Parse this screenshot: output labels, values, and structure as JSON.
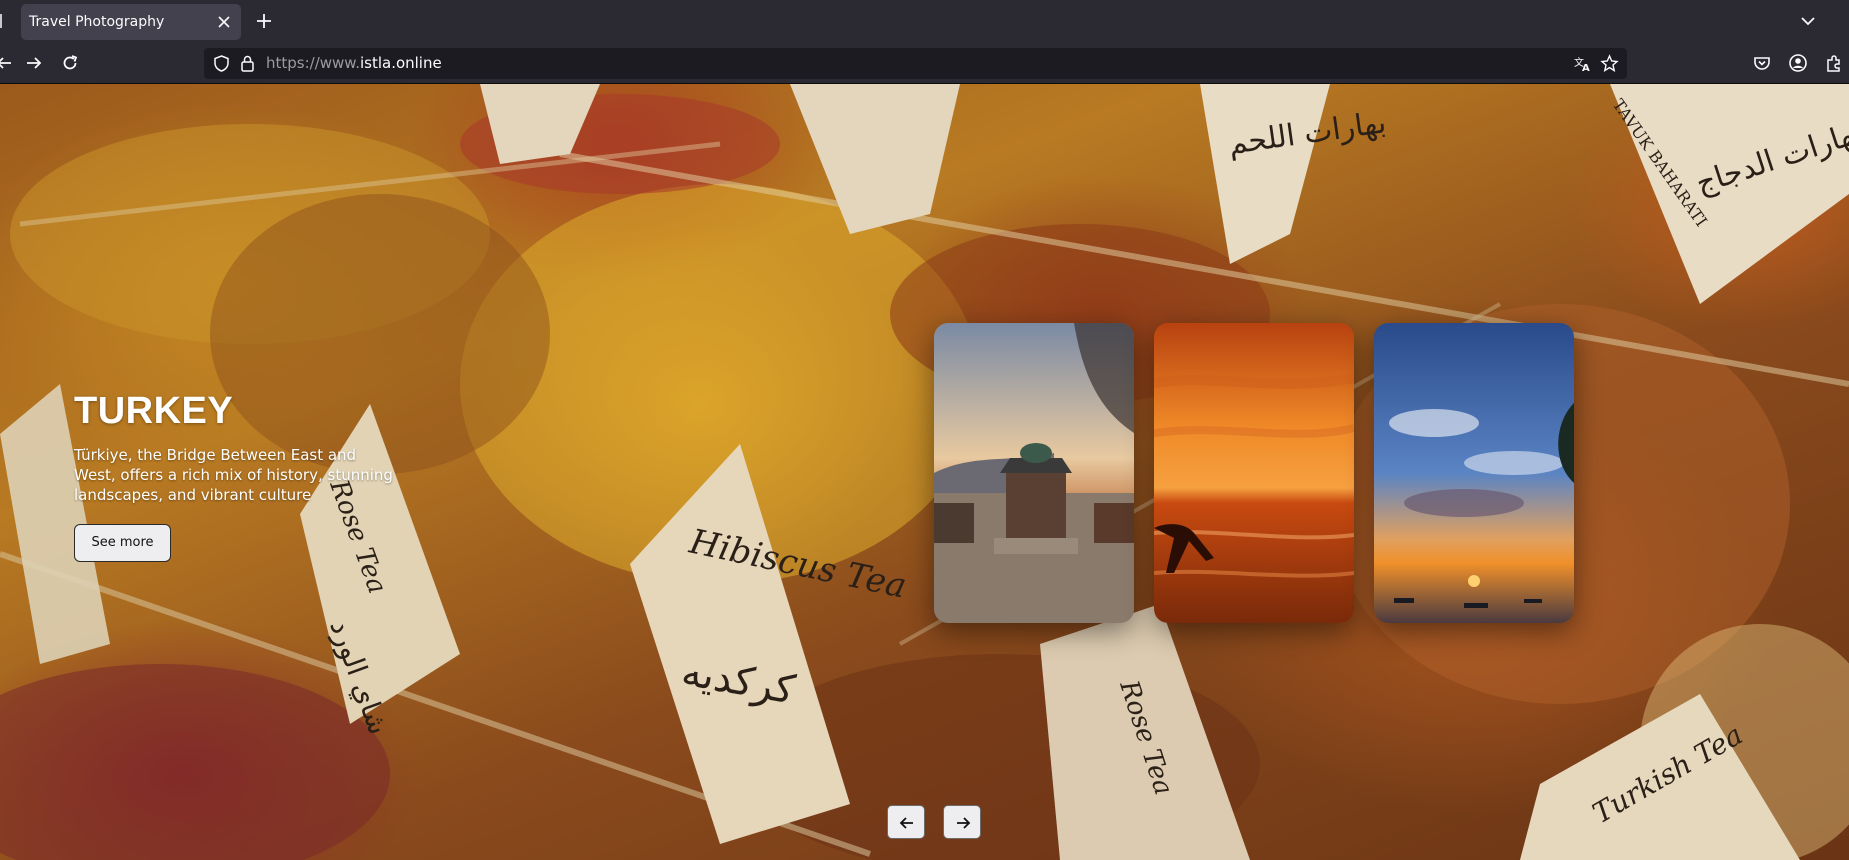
{
  "browser": {
    "tab": {
      "title": "Travel Photography"
    },
    "url": {
      "prefix": "https://www.",
      "host": "istla.online"
    },
    "icons": [
      "back-arrow-icon",
      "forward-arrow-icon",
      "reload-icon",
      "shield-icon",
      "lock-icon",
      "translate-icon",
      "bookmark-star-icon",
      "pocket-icon",
      "account-icon",
      "extensions-icon",
      "new-tab-plus-icon",
      "tab-list-chevron-icon",
      "close-tab-icon"
    ]
  },
  "hero": {
    "title": "TURKEY",
    "description": "Türkiye, the Bridge Between East and West, offers a rich mix of history, stunning landscapes, and vibrant culture",
    "cta": "See more"
  },
  "background": {
    "signs": [
      "Hibiscus Tea",
      "كركديه",
      "Rose Tea",
      "شاي الورد",
      "بهارات اللحم",
      "TAVUK BAHARATI",
      "بهارات الدجاج",
      "Turkish Tea",
      "Rose Tea"
    ]
  },
  "gallery": {
    "cards": [
      {
        "subject": "mosque-fountain-sunset"
      },
      {
        "subject": "orange-sea-sunset"
      },
      {
        "subject": "blue-sky-sunset-boats"
      }
    ]
  },
  "controls": {
    "prev_icon": "arrow-left-icon",
    "next_icon": "arrow-right-icon"
  },
  "colors": {
    "chrome": "#2b2a33",
    "urlbar": "#1c1b22",
    "button_bg": "#eeeef0"
  }
}
